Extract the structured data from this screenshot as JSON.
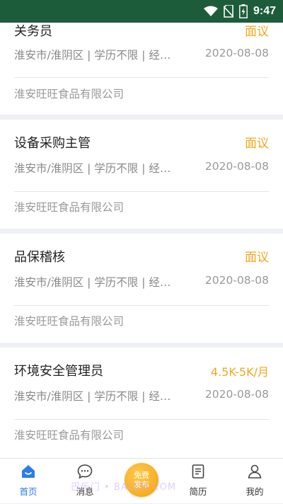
{
  "status_bar": {
    "time": "9:47"
  },
  "jobs": [
    {
      "title": "关务员",
      "salary": "面议",
      "meta": "淮安市/淮阴区 | 学历不限 | 经验不限",
      "date": "2020-08-08",
      "company": "淮安旺旺食品有限公司"
    },
    {
      "title": "设备采购主管",
      "salary": "面议",
      "meta": "淮安市/淮阴区 | 学历不限 | 经验不限",
      "date": "2020-08-08",
      "company": "淮安旺旺食品有限公司"
    },
    {
      "title": "品保稽核",
      "salary": "面议",
      "meta": "淮安市/淮阴区 | 学历不限 | 经验不限",
      "date": "2020-08-08",
      "company": "淮安旺旺食品有限公司"
    },
    {
      "title": "环境安全管理员",
      "salary": "4.5K-5K/月",
      "meta": "淮安市/淮阴区 | 学历不限 | 经验不限",
      "date": "2020-08-08",
      "company": "淮安旺旺食品有限公司"
    }
  ],
  "tabbar": {
    "home": "首页",
    "messages": "消息",
    "publish_line1": "免费",
    "publish_line2": "发布",
    "resume": "简历",
    "mine": "我的"
  },
  "watermark": "巴乐门 • BALEM.COM"
}
